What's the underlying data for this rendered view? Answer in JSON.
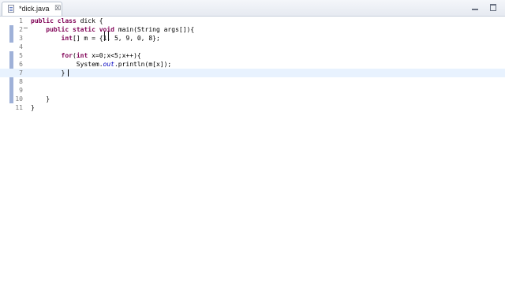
{
  "tab": {
    "title": "*dick.java",
    "close_glyph": "☒"
  },
  "window": {
    "minimize_icon": "minimize-icon",
    "maximize_icon": "maximize-icon"
  },
  "editor": {
    "lines": [
      {
        "number": "1",
        "code": "public class dick {"
      },
      {
        "number": "2",
        "code": "    public static void main(String args[]){"
      },
      {
        "number": "3",
        "code": "        int[] m = {1, 5, 9, 0, 8};"
      },
      {
        "number": "4",
        "code": ""
      },
      {
        "number": "5",
        "code": "        for(int x=0;x<5;x++){"
      },
      {
        "number": "6",
        "code": "            System.out.println(m[x]);"
      },
      {
        "number": "7",
        "code": "        }"
      },
      {
        "number": "8",
        "code": ""
      },
      {
        "number": "9",
        "code": ""
      },
      {
        "number": "10",
        "code": "    }"
      },
      {
        "number": "11",
        "code": "}"
      }
    ],
    "current_line": 7
  }
}
